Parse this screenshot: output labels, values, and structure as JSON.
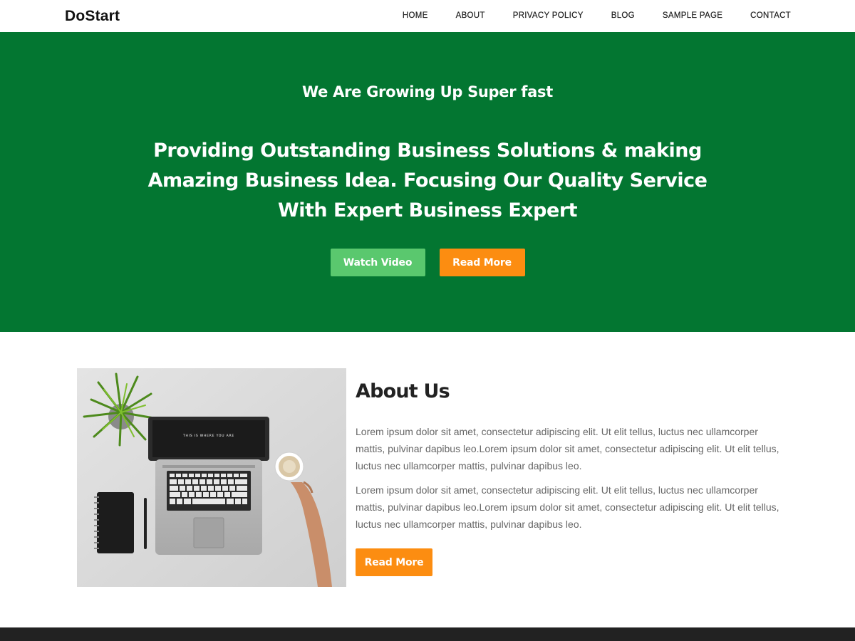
{
  "header": {
    "logo": "DoStart",
    "nav": [
      "HOME",
      "ABOUT",
      "PRIVACY POLICY",
      "BLOG",
      "SAMPLE PAGE",
      "CONTACT"
    ]
  },
  "hero": {
    "subtitle": "We Are Growing Up Super fast",
    "title": "Providing Outstanding Business Solutions & making Amazing Business Idea. Focusing Our Quality Service With Expert Business Expert",
    "watch_label": "Watch Video",
    "read_more_label": "Read More"
  },
  "about": {
    "title": "About Us",
    "paragraphs": [
      "Lorem ipsum dolor sit amet, consectetur adipiscing elit. Ut elit tellus, luctus nec ullamcorper mattis, pulvinar dapibus leo.Lorem ipsum dolor sit amet, consectetur adipiscing elit. Ut elit tellus, luctus nec ullamcorper mattis, pulvinar dapibus leo.",
      "Lorem ipsum dolor sit amet, consectetur adipiscing elit. Ut elit tellus, luctus nec ullamcorper mattis, pulvinar dapibus leo.Lorem ipsum dolor sit amet, consectetur adipiscing elit. Ut elit tellus, luctus nec ullamcorper mattis, pulvinar dapibus leo."
    ],
    "read_more_label": "Read More",
    "screen_text": "THIS IS WHERE YOU ARE"
  },
  "colors": {
    "hero_bg": "#037631",
    "green_button": "#5ac86e",
    "orange_button": "#fc8d11",
    "footer_bg": "#222222"
  }
}
